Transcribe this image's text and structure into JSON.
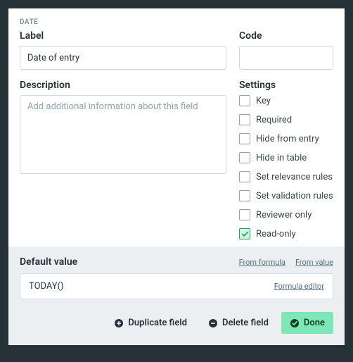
{
  "type_badge": "DATE",
  "label": {
    "caption": "Label",
    "value": "Date of entry"
  },
  "code": {
    "caption": "Code",
    "value": ""
  },
  "description": {
    "caption": "Description",
    "placeholder": "Add additional information about this field",
    "value": ""
  },
  "settings": {
    "caption": "Settings",
    "items": [
      {
        "label": "Key",
        "checked": false
      },
      {
        "label": "Required",
        "checked": false
      },
      {
        "label": "Hide from entry",
        "checked": false
      },
      {
        "label": "Hide in table",
        "checked": false
      },
      {
        "label": "Set relevance rules",
        "checked": false
      },
      {
        "label": "Set validation rules",
        "checked": false
      },
      {
        "label": "Reviewer only",
        "checked": false
      },
      {
        "label": "Read-only",
        "checked": true
      }
    ]
  },
  "default_value": {
    "caption": "Default value",
    "from_formula": "From formula",
    "from_value": "From value",
    "formula": "TODAY()",
    "editor_link": "Formula editor"
  },
  "actions": {
    "duplicate": "Duplicate field",
    "delete": "Delete field",
    "done": "Done"
  }
}
